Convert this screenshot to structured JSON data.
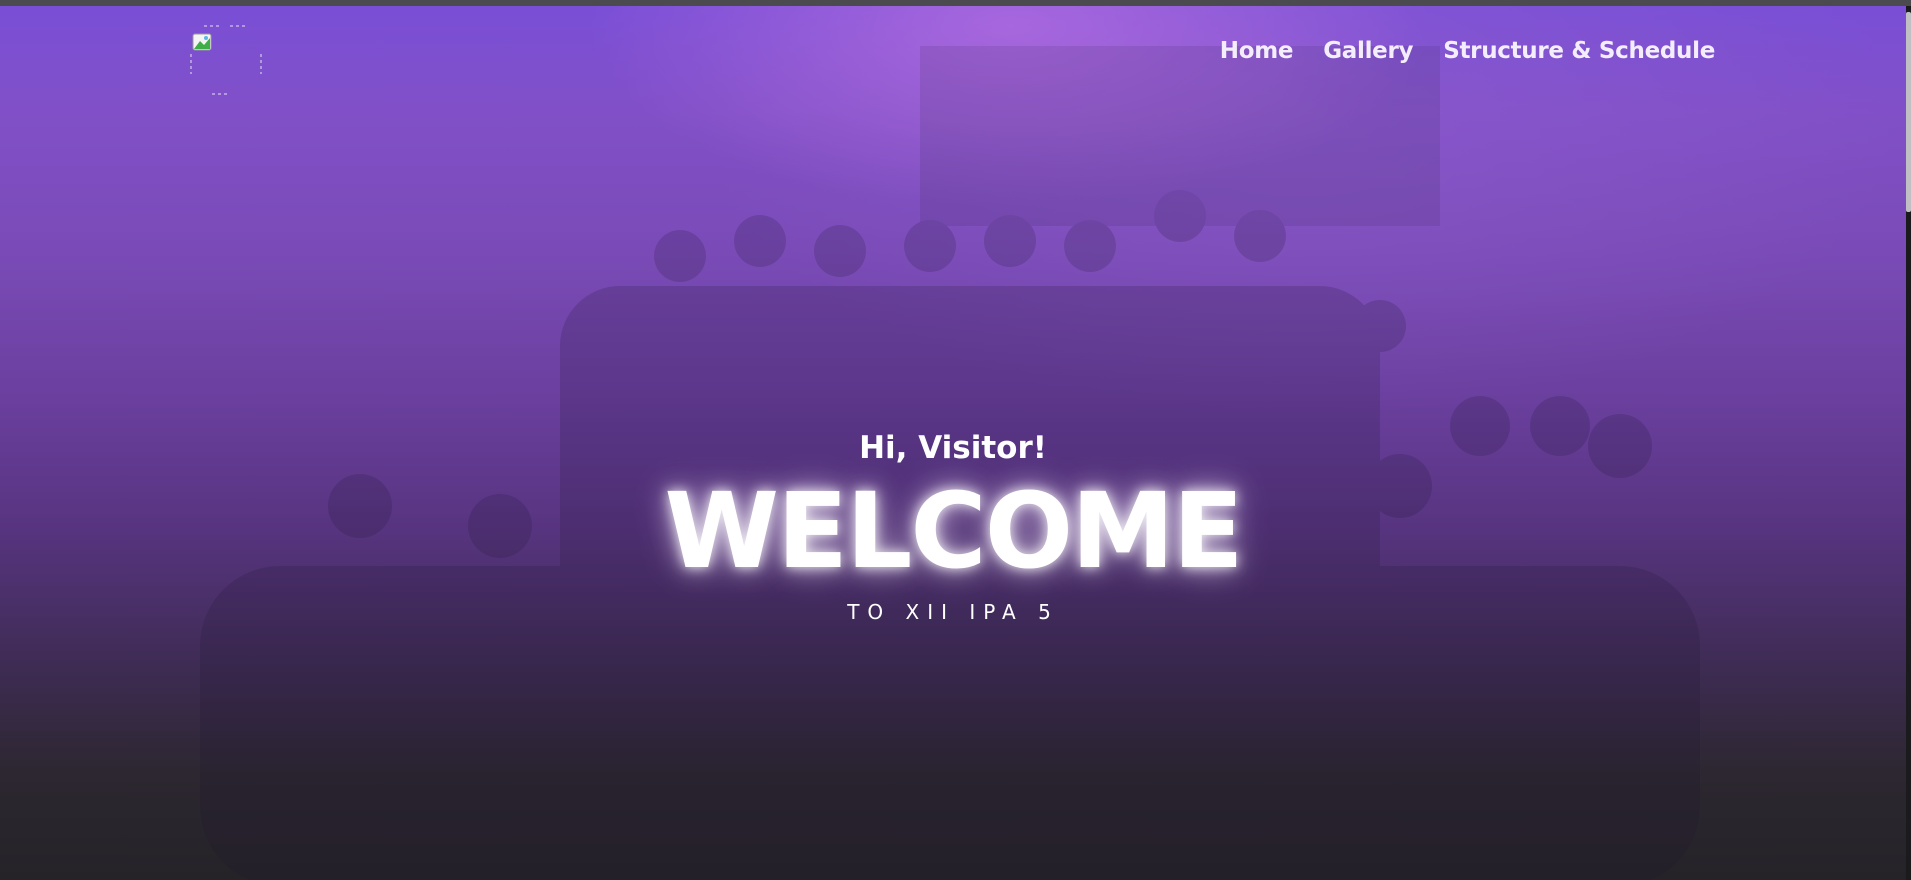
{
  "nav": {
    "items": [
      {
        "label": "Home"
      },
      {
        "label": "Gallery"
      },
      {
        "label": "Structure & Schedule"
      }
    ]
  },
  "hero": {
    "greeting": "Hi, Visitor!",
    "title": "WELCOME",
    "subtitle": "TO XII IPA 5"
  },
  "icons": {
    "logo": "broken-image-icon"
  },
  "colors": {
    "gradient_top": "#7a4fd6",
    "gradient_mid": "#6a3f9e",
    "gradient_bottom": "#252328",
    "text": "#ffffff"
  }
}
